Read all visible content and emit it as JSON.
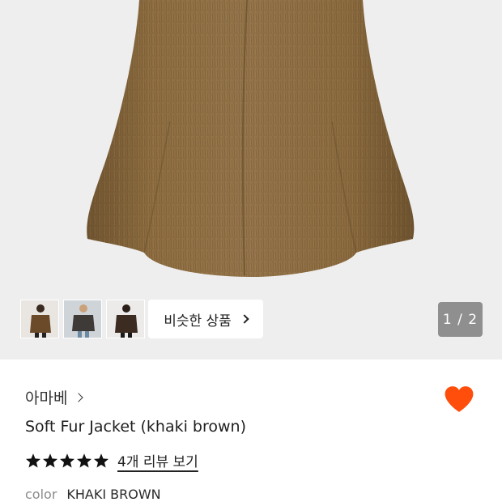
{
  "gallery": {
    "thumbnails": [
      "thumbnail-1",
      "thumbnail-2",
      "thumbnail-3"
    ],
    "similar_label": "비슷한 상품",
    "page_counter": "1 / 2",
    "current_page": 1,
    "total_pages": 2
  },
  "product": {
    "brand": "아마베",
    "title": "Soft Fur Jacket (khaki brown)",
    "rating_stars": 5,
    "review_link": "4개 리뷰 보기",
    "color_label": "color",
    "color_value": "KHAKI BROWN",
    "liked": true
  },
  "colors": {
    "heart": "#ff4d0b",
    "fur": "#8a6a3c",
    "background": "#efeeee",
    "counter_bg": "#8f8f8f"
  }
}
